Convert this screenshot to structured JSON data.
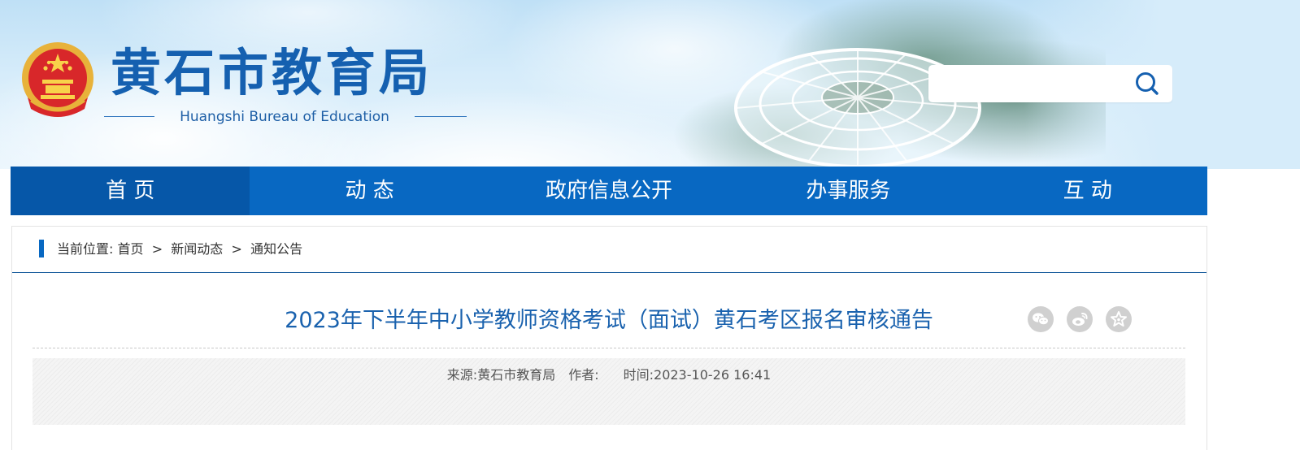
{
  "header": {
    "site_title": "黄石市教育局",
    "site_subtitle": "Huangshi Bureau of Education",
    "search": {
      "value": "",
      "placeholder": ""
    }
  },
  "nav": {
    "items": [
      {
        "label": "首 页",
        "active": true
      },
      {
        "label": "动 态",
        "active": false
      },
      {
        "label": "政府信息公开",
        "active": false
      },
      {
        "label": "办事服务",
        "active": false
      },
      {
        "label": "互 动",
        "active": false
      }
    ]
  },
  "breadcrumb": {
    "prefix": "当前位置:",
    "items": [
      "首页",
      "新闻动态",
      "通知公告"
    ],
    "separator": ">"
  },
  "article": {
    "title": "2023年下半年中小学教师资格考试（面试）黄石考区报名审核通告",
    "source_label": "来源:",
    "source": "黄石市教育局",
    "author_label": "作者:",
    "author": "",
    "time_label": "时间:",
    "time": "2023-10-26 16:41"
  },
  "share": {
    "icons": [
      "wechat-icon",
      "weibo-icon",
      "favorite-icon"
    ]
  },
  "colors": {
    "brand_blue": "#0868c2",
    "nav_active": "#0657a8",
    "title_blue": "#1a62ae"
  }
}
